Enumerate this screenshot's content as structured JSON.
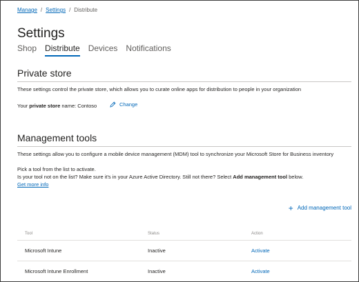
{
  "breadcrumb": {
    "manage": "Manage",
    "settings": "Settings",
    "current": "Distribute",
    "sep": "/"
  },
  "page": {
    "title": "Settings"
  },
  "tabs": [
    {
      "label": "Shop",
      "active": false
    },
    {
      "label": "Distribute",
      "active": true
    },
    {
      "label": "Devices",
      "active": false
    },
    {
      "label": "Notifications",
      "active": false
    }
  ],
  "private_store": {
    "title": "Private store",
    "description": "These settings control the private store, which allows you to curate online apps for distribution to people in your organization",
    "name_prefix": "Your ",
    "name_bold": "private store",
    "name_suffix": " name: Contoso",
    "change_label": "Change"
  },
  "management_tools": {
    "title": "Management tools",
    "description": "These settings allow you to configure a mobile device management (MDM) tool to synchronize your Microsoft Store for Business inventory",
    "pick_text": "Pick a tool from the list to activate.",
    "not_listed_prefix": "Is your tool not on the list? Make sure it's in your Azure Active Directory. Still not there? Select ",
    "not_listed_bold": "Add management tool",
    "not_listed_suffix": " below.",
    "more_info": "Get more info",
    "add_tool_label": "Add management tool",
    "columns": {
      "tool": "Tool",
      "status": "Status",
      "action": "Action"
    },
    "rows": [
      {
        "tool": "Microsoft Intune",
        "status": "Inactive",
        "action": "Activate"
      },
      {
        "tool": "Microsoft Intune Enrollment",
        "status": "Inactive",
        "action": "Activate"
      }
    ]
  },
  "colors": {
    "accent": "#0067b8",
    "text": "#201f1e",
    "muted": "#605e5c"
  },
  "icons": {
    "change": "pencil-icon",
    "add": "plus-icon"
  }
}
